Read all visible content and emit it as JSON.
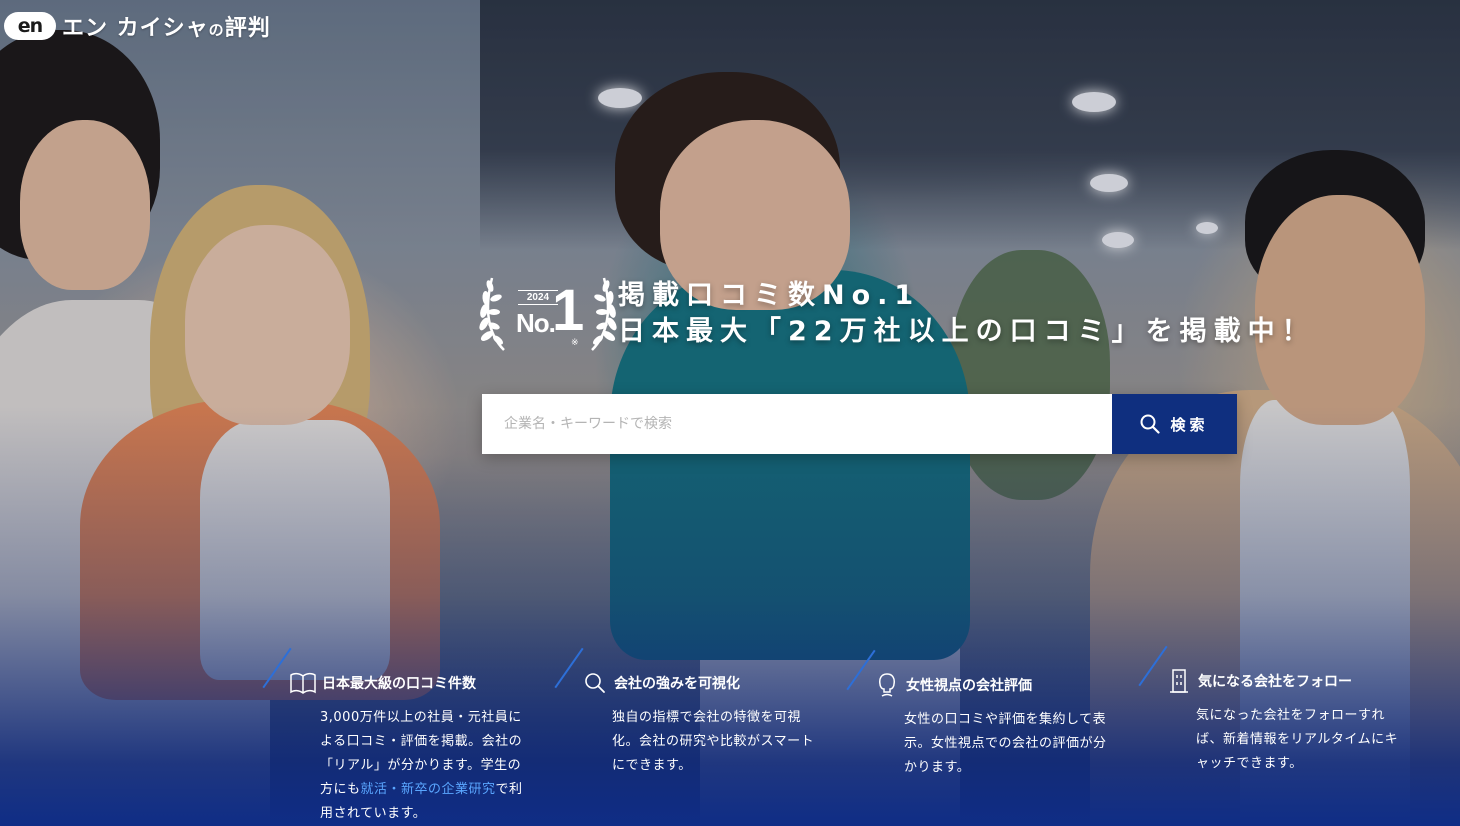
{
  "logo": {
    "mark": "en",
    "name": "エン カイシャ",
    "no": "の",
    "suffix": "評判"
  },
  "badge": {
    "year": "2024",
    "no": "No.",
    "one": "1",
    "note": "※"
  },
  "headline": {
    "line1": "掲載口コミ数No.1",
    "line2": "日本最大「22万社以上の口コミ」を掲載中！"
  },
  "search": {
    "placeholder": "企業名・キーワードで検索",
    "button_label": "検索",
    "button_icon": "search-icon"
  },
  "features": [
    {
      "icon": "book-icon",
      "title": "日本最大級の口コミ件数",
      "desc_before": "3,000万件以上の社員・元社員による口コミ・評価を掲載。会社の「リアル」が分かります。学生の方にも",
      "link": "就活・新卒の企業研究",
      "desc_after": "で利用されています。"
    },
    {
      "icon": "search-icon",
      "title": "会社の強みを可視化",
      "desc": "独自の指標で会社の特徴を可視化。会社の研究や比較がスマートにできます。"
    },
    {
      "icon": "woman-icon",
      "title": "女性視点の会社評価",
      "desc": "女性の口コミや評価を集約して表示。女性視点での会社の評価が分かります。"
    },
    {
      "icon": "building-icon",
      "title": "気になる会社をフォロー",
      "desc": "気になった会社をフォローすれば、新着情報をリアルタイムにキャッチできます。"
    }
  ],
  "colors": {
    "accent": "#0f2f7f",
    "link": "#5aa6ff",
    "slash": "#2d6fd8"
  }
}
